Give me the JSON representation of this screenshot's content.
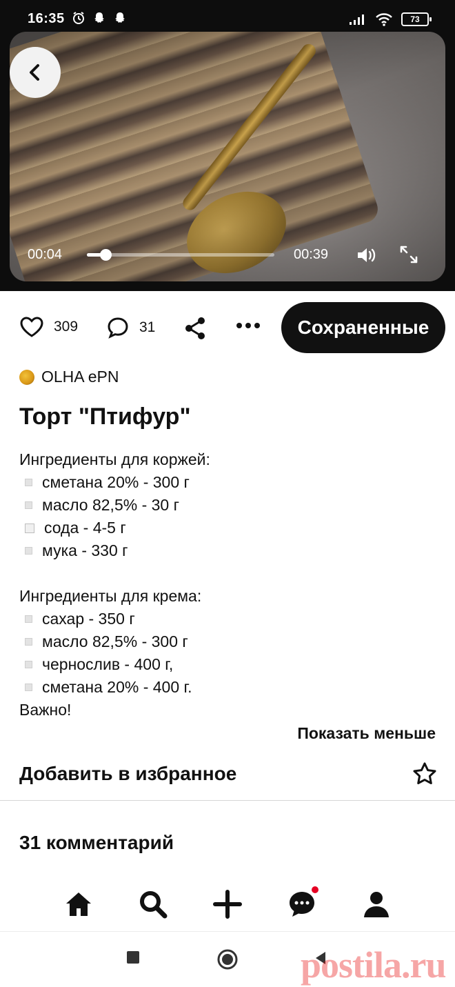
{
  "status_bar": {
    "time": "16:35",
    "battery": "73"
  },
  "video": {
    "current_time": "00:04",
    "duration": "00:39",
    "progress": 0.1
  },
  "actions": {
    "likes": "309",
    "comments": "31",
    "save_label": "Сохраненные"
  },
  "author": {
    "name": "OLHA ePN"
  },
  "pin": {
    "title": "Торт \"Птифур\"",
    "description": [
      {
        "type": "text",
        "text": "Ингредиенты для коржей:"
      },
      {
        "type": "item",
        "text": "сметана 20% - 300 г"
      },
      {
        "type": "item",
        "text": "масло 82,5% - 30 г"
      },
      {
        "type": "item",
        "text": "сода - 4-5 г"
      },
      {
        "type": "item",
        "text": "мука - 330 г"
      },
      {
        "type": "blank",
        "text": ""
      },
      {
        "type": "text",
        "text": "Ингредиенты для крема:"
      },
      {
        "type": "item",
        "text": "сахар - 350 г"
      },
      {
        "type": "item",
        "text": "масло 82,5% - 300 г"
      },
      {
        "type": "item",
        "text": "чернослив - 400 г,"
      },
      {
        "type": "item",
        "text": "сметана 20% - 400 г."
      },
      {
        "type": "text",
        "text": "Важно!"
      }
    ],
    "show_less": "Показать меньше"
  },
  "favorites": {
    "label": "Добавить в избранное"
  },
  "comments_section": {
    "title": "31 комментарий"
  },
  "bottom_nav": [
    "home-icon",
    "search-icon",
    "plus-icon",
    "messages-icon",
    "profile-icon"
  ],
  "watermark": "postila.ru",
  "colors": {
    "accent": "#e60023",
    "dark": "#111111"
  }
}
